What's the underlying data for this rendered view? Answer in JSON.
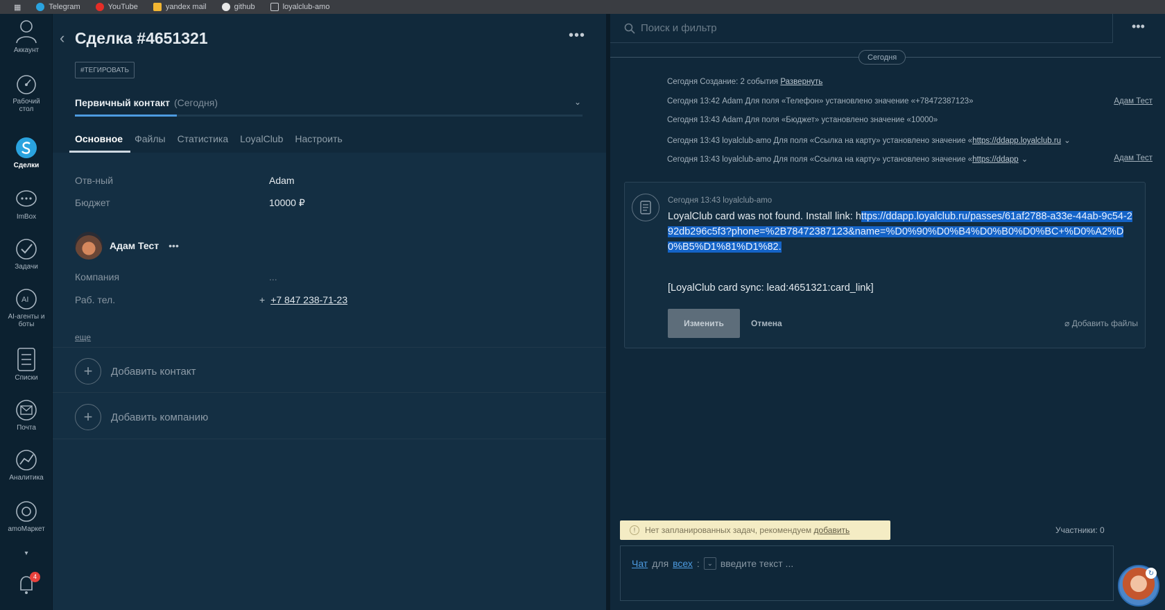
{
  "browser": {
    "bookmarks": [
      "Telegram",
      "YouTube",
      "yandex mail",
      "github",
      "loyalclub-amo"
    ]
  },
  "rail": {
    "items": [
      {
        "label": "Аккаунт",
        "icon": "account-icon"
      },
      {
        "label": "Рабочий стол",
        "icon": "dashboard-icon"
      },
      {
        "label": "Сделки",
        "icon": "deals-icon"
      },
      {
        "label": "ImBox",
        "icon": "chat-icon"
      },
      {
        "label": "Задачи",
        "icon": "tasks-icon"
      },
      {
        "label": "AI-агенты и боты",
        "icon": "ai-icon"
      },
      {
        "label": "Списки",
        "icon": "lists-icon"
      },
      {
        "label": "Почта",
        "icon": "mail-icon"
      },
      {
        "label": "Аналитика",
        "icon": "analytics-icon"
      },
      {
        "label": "amoМаркет",
        "icon": "market-icon"
      }
    ],
    "notifications_badge": "4"
  },
  "lead": {
    "title": "Сделка #4651321",
    "tag_button": "#ТЕГИРОВАТЬ",
    "pipeline_stage": "Первичный контакт",
    "pipeline_date": "(Сегодня)",
    "tabs": [
      "Основное",
      "Файлы",
      "Статистика",
      "LoyalClub",
      "Настроить"
    ],
    "fields": {
      "responsible_label": "Отв-ный",
      "responsible_value": "Adam",
      "budget_label": "Бюджет",
      "budget_value": "10000 ₽"
    },
    "contact": {
      "name": "Адам Тест",
      "company_label": "Компания",
      "company_value": "...",
      "phone_label": "Раб. тел.",
      "phone_value": "+7 847 238-71-23",
      "more_link": "еще"
    },
    "add_contact": "Добавить контакт",
    "add_company": "Добавить компанию"
  },
  "feed": {
    "search_placeholder": "Поиск и фильтр",
    "date_pill": "Сегодня",
    "events": [
      {
        "text": "Сегодня Создание: 2 события ",
        "link": "Развернуть",
        "author": ""
      },
      {
        "text": "Сегодня 13:42 Adam Для поля «Телефон» установлено значение «+78472387123»",
        "link": "",
        "author": "Адам Тест"
      },
      {
        "text": "Сегодня 13:43 Adam Для поля «Бюджет» установлено значение «10000»",
        "link": "",
        "author": ""
      },
      {
        "text": "Сегодня 13:43 loyalclub-amo Для поля «Ссылка на карту» установлено значение «",
        "link": "https://ddapp.loyalclub.ru",
        "author": ""
      },
      {
        "text": "Сегодня 13:43 loyalclub-amo Для поля «Ссылка на карту» установлено значение «",
        "link": "https://ddapp",
        "author": "Адам Тест"
      }
    ],
    "note": {
      "meta": "Сегодня 13:43 loyalclub-amo",
      "text_prefix": "LoyalClub card was not found. Install link: h",
      "text_link": "ttps://ddapp.loyalclub.ru/passes/61af2788-a33e-44ab-9c54-292db296c5f3?phone=%2B78472387123&name=%D0%90%D0%B4%D0%B0%D0%BC+%D0%A2%D0%B5%D1%81%D1%82.",
      "sync": "[LoyalClub card sync: lead:4651321:card_link]",
      "save_button": "Изменить",
      "cancel_button": "Отмена",
      "attach": "Добавить файлы"
    },
    "tasks_notice": "Нет запланированных задач, рекомендуем ",
    "tasks_link": "добавить",
    "participants": "Участники: 0",
    "chat": {
      "chat_link": "Чат",
      "for_text": "для",
      "all_link": "всех",
      "placeholder": "введите текст ..."
    }
  }
}
